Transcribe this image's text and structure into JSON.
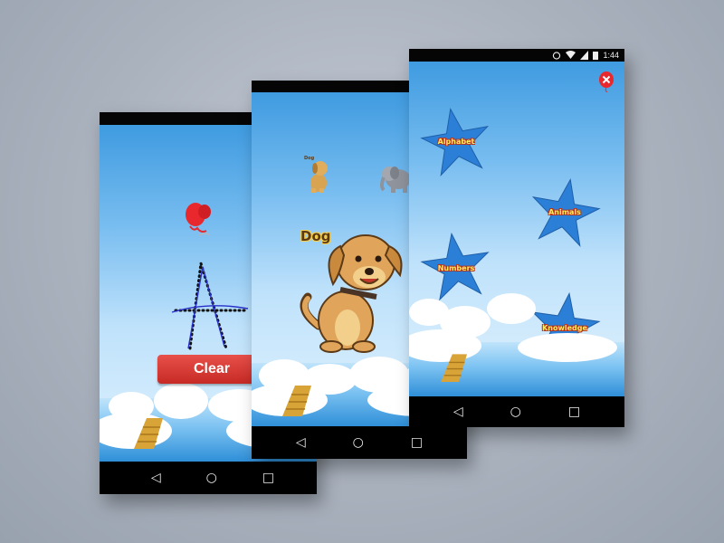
{
  "status": {
    "time": "1:44"
  },
  "nav": {
    "back": "◁",
    "home": "○",
    "recents": "□"
  },
  "screen_tracing": {
    "letter": "Ao",
    "clear_label": "Clear"
  },
  "screen_animals": {
    "small_label": "Dog",
    "word_label": "Dog"
  },
  "screen_menu": {
    "stars": [
      {
        "label": "Alphabet"
      },
      {
        "label": "Animals"
      },
      {
        "label": "Numbers"
      },
      {
        "label": "Knowledge"
      }
    ]
  },
  "colors": {
    "star": "#2c7fd6",
    "clear_button": "#d9393a",
    "balloon": "#e8282c"
  }
}
